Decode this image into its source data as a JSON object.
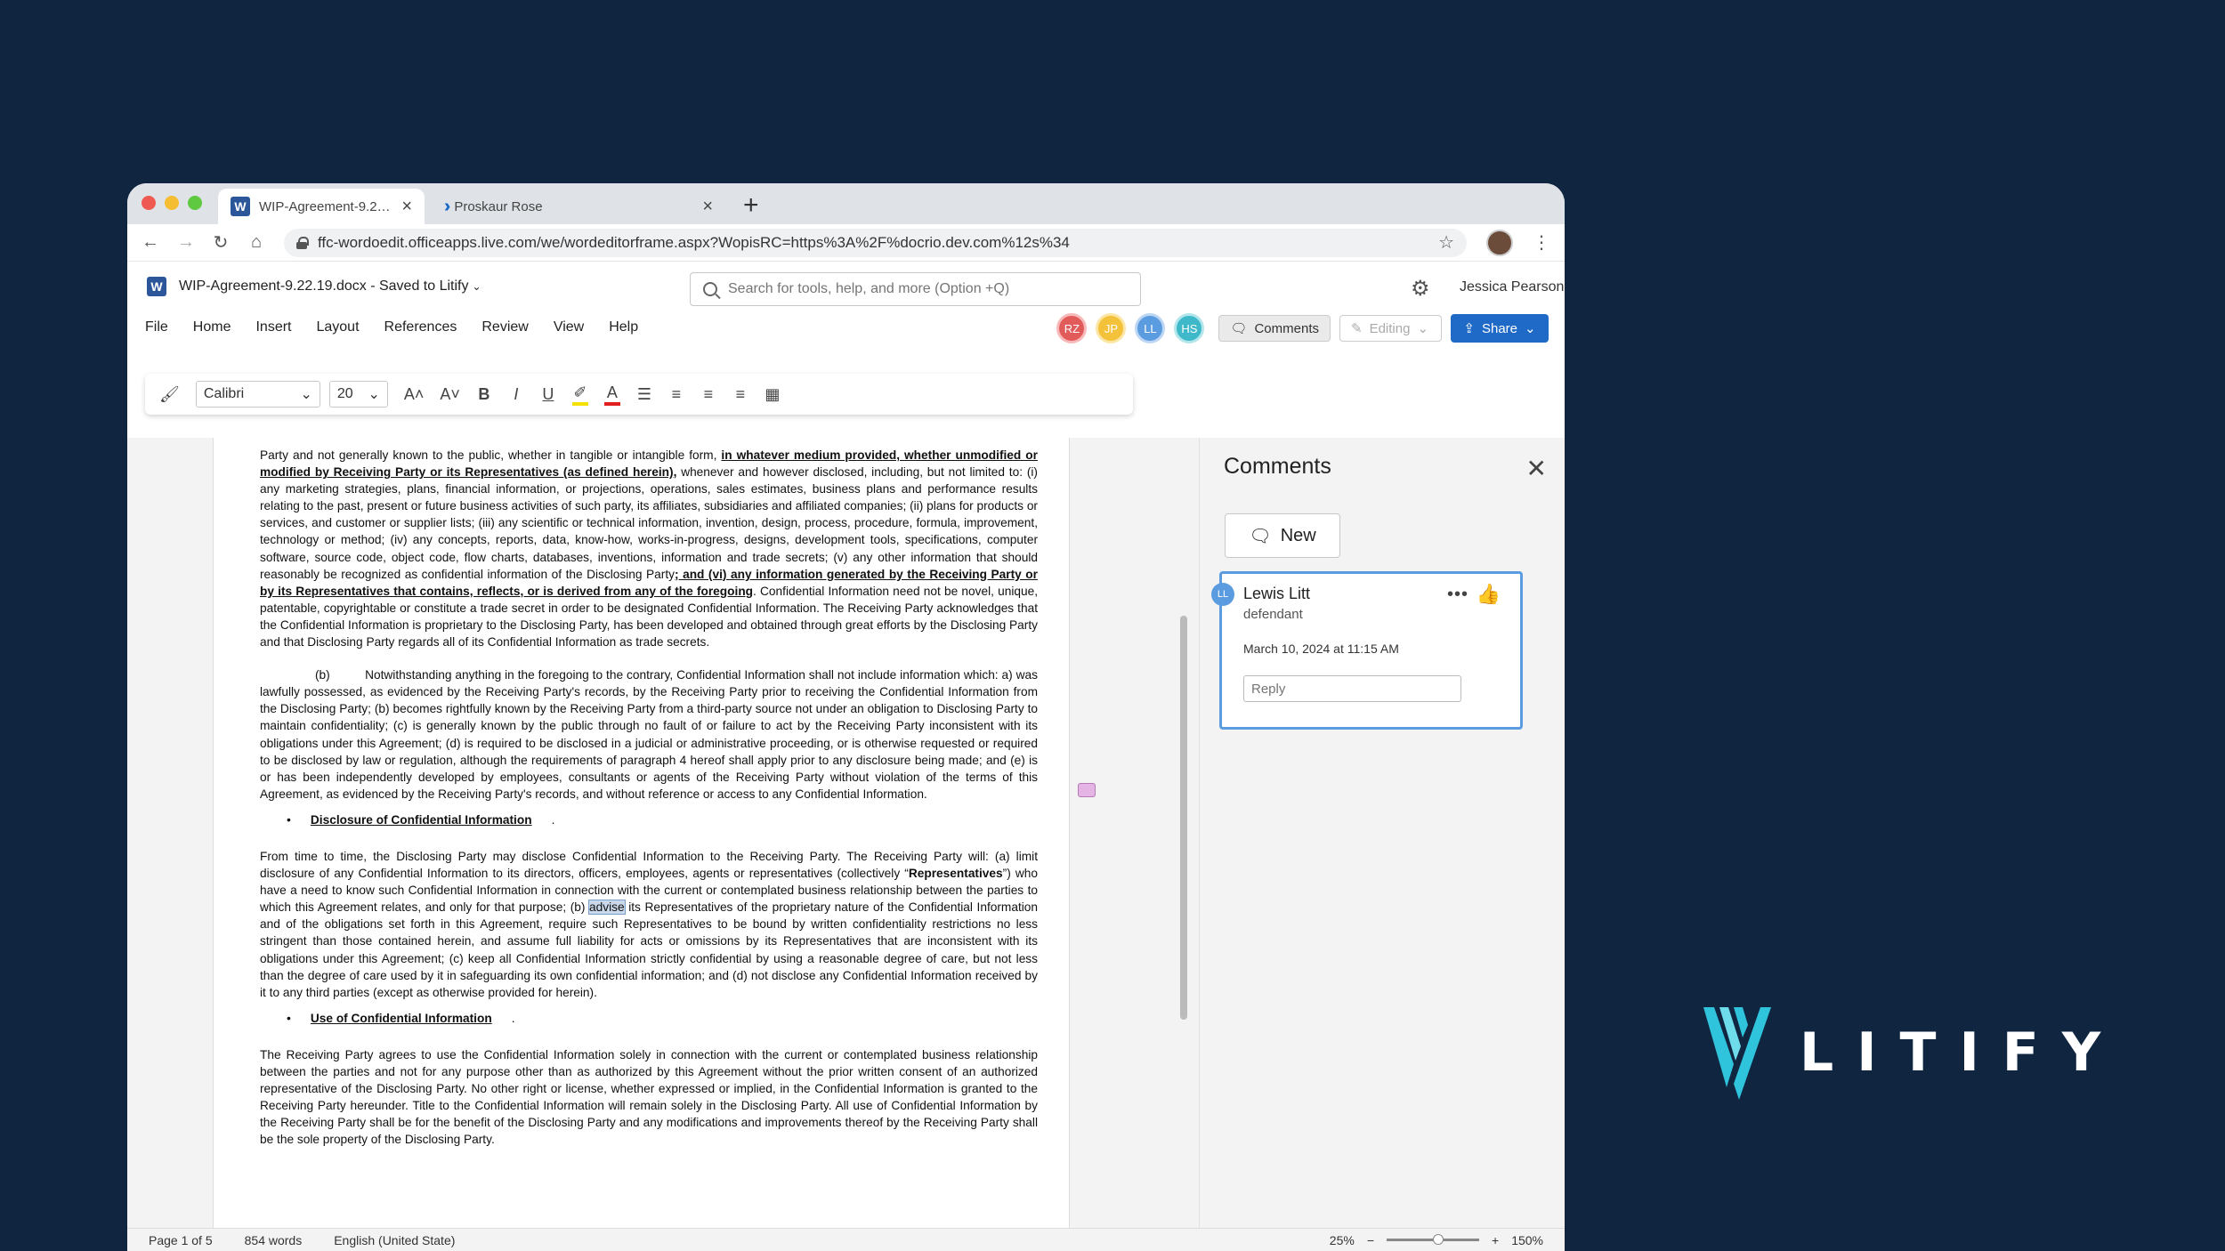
{
  "browser": {
    "tabs": [
      {
        "title": "WIP-Agreement-9.22...",
        "active": true,
        "icon": "word-icon"
      },
      {
        "title": "Proskaur Rose",
        "active": false,
        "icon": "litify-tab-icon"
      }
    ],
    "new_tab_label": "+",
    "url": "ffc-wordoedit.officeapps.live.com/we/wordeditorframe.aspx?WopisRC=https%3A%2F%docrio.dev.com%12s%34"
  },
  "word": {
    "doc_title": "WIP-Agreement-9.22.19.docx - Saved to Litify",
    "search_placeholder": "Search for tools, help, and more (Option +Q)",
    "user_name": "Jessica Pearson",
    "menu": [
      "File",
      "Home",
      "Insert",
      "Layout",
      "References",
      "Review",
      "View",
      "Help"
    ],
    "collaborators": [
      {
        "initials": "RZ",
        "color": "#e25b5b"
      },
      {
        "initials": "JP",
        "color": "#f3c13a"
      },
      {
        "initials": "LL",
        "color": "#5b9be0"
      },
      {
        "initials": "HS",
        "color": "#3fb9c9"
      }
    ],
    "comments_btn": "Comments",
    "editing_btn": "Editing",
    "share_btn": "Share",
    "ribbon": {
      "font": "Calibri",
      "size": "20",
      "bold": "B",
      "italic": "I",
      "underline": "U"
    }
  },
  "document": {
    "p1_a": "Party and not generally known to the public, whether in tangible or intangible form, ",
    "p1_b": "in whatever medium provided, whether unmodified or modified by Receiving Party or its Representatives (as defined herein),",
    "p1_c": " whenever and however disclosed, including, but not limited to: (i) any marketing strategies, plans, financial information, or projections, operations, sales estimates, business plans and performance results relating to the past, present or future business activities of such party, its affiliates, subsidiaries and affiliated companies; (ii) plans for products or services, and customer or supplier lists; (iii) any scientific or technical information, invention, design, process, procedure, formula, improvement, technology or method; (iv) any concepts, reports, data, know-how, works-in-progress, designs, development tools, specifications, computer software, source code, object code, flow charts, databases, inventions, information and trade secrets; (v) any other information that should reasonably be recognized as confidential information of the Disclosing Party",
    "p1_d": "; and (vi) any information generated by the Receiving Party or by its Representatives that contains, reflects, or is derived from any of the foregoing",
    "p1_e": ". Confidential Information need not be novel, unique, patentable, copyrightable or constitute a trade secret in order to be designated Confidential Information. The Receiving Party acknowledges that the Confidential Information is proprietary to the Disclosing Party, has been developed and obtained through great efforts by the Disclosing Party and that Disclosing Party regards all of its Confidential Information as trade secrets.",
    "p2": "(b)          Notwithstanding anything in the foregoing to the contrary, Confidential Information shall not include information which: a) was lawfully possessed, as evidenced by the Receiving Party's records, by the Receiving Party prior to receiving the Confidential Information from the Disclosing Party; (b) becomes rightfully known by the Receiving Party from a third-party source not under an obligation to Disclosing Party to maintain confidentiality; (c) is generally known by the public through no fault of or failure to act by the Receiving Party inconsistent with its obligations under this Agreement; (d) is required to be disclosed in a judicial or administrative proceeding, or is otherwise requested or required to be disclosed by law or regulation, although the requirements of paragraph 4 hereof shall apply prior to any disclosure being made; and (e) is or has been independently developed by employees, consultants or agents of the Receiving Party without violation of the terms of this Agreement, as evidenced by the Receiving Party's records, and without reference or access to any Confidential Information.",
    "heading1": "Disclosure of Confidential Information",
    "p3_a": "From time to time, the Disclosing Party may disclose Confidential Information to the Receiving Party. The Receiving Party will: (a) limit disclosure of any Confidential Information to its directors, officers, employees, agents or representatives (collectively “",
    "p3_bold": "Representatives",
    "p3_b": "”) who have a need to know such Confidential Information in connection with the current or contemplated business relationship between the parties to which this Agreement relates, and only for that purpose; (b) ",
    "p3_hl": "advise",
    "p3_c": " its Representatives of the proprietary nature of the Confidential Information and of the obligations set forth in this Agreement, require such Representatives to be bound by written confidentiality restrictions no less stringent than those contained herein, and assume full liability for acts or omissions by its Representatives that are inconsistent with its obligations under this Agreement; (c) keep all Confidential Information strictly confidential by using a reasonable degree of care, but not less than the degree of care used by it in safeguarding its own confidential information; and (d) not disclose any Confidential Information received by it to any third parties (except as otherwise provided for herein).",
    "heading2": "Use of Confidential Information",
    "p4": "The Receiving Party agrees to use the Confidential Information solely in connection with the current or contemplated business relationship between the parties and not for any purpose other than as authorized by this Agreement without the prior written consent of an authorized representative of the Disclosing Party. No other right or license, whether expressed or implied, in the Confidential Information is granted to the Receiving Party hereunder. Title to the Confidential Information will remain solely in the Disclosing Party. All use of Confidential Information by the Receiving Party shall be for the benefit of the Disclosing Party and any modifications and improvements thereof by the Receiving Party shall be the sole property of the Disclosing Party."
  },
  "comments_pane": {
    "title": "Comments",
    "new_btn": "New",
    "comment": {
      "initials": "LL",
      "author": "Lewis Litt",
      "role": "defendant",
      "date": "March 10, 2024 at 11:15 AM",
      "reply_placeholder": "Reply"
    }
  },
  "status": {
    "page": "Page 1 of 5",
    "words": "854 words",
    "language": "English (United State)",
    "zoom_min": "25%",
    "zoom_max": "150%",
    "zoom_minus": "−",
    "zoom_plus": "+"
  },
  "brand": {
    "name": "LITIFY",
    "accent": "#2fc4dc",
    "background": "#0f2540"
  }
}
